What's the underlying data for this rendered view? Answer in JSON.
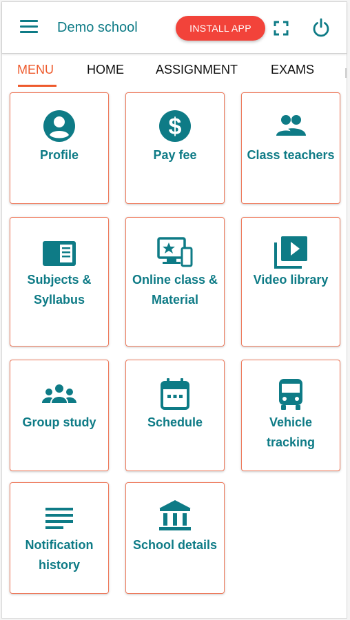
{
  "header": {
    "school_name": "Demo school",
    "install_label": "INSTALL APP",
    "menu_icon": "hamburger-menu-icon",
    "fullscreen_icon": "fullscreen-icon",
    "power_icon": "power-icon"
  },
  "tabs": [
    {
      "label": "MENU",
      "active": true
    },
    {
      "label": "HOME",
      "active": false
    },
    {
      "label": "ASSIGNMENT",
      "active": false
    },
    {
      "label": "EXAMS",
      "active": false
    }
  ],
  "tiles": [
    {
      "label": "Profile",
      "icon": "profile-icon"
    },
    {
      "label": "Pay fee",
      "icon": "dollar-icon"
    },
    {
      "label": "Class teachers",
      "icon": "people-icon"
    },
    {
      "label": "Subjects & Syllabus",
      "icon": "book-icon"
    },
    {
      "label": "Online class & Material",
      "icon": "online-class-icon"
    },
    {
      "label": "Video library",
      "icon": "video-library-icon"
    },
    {
      "label": "Group study",
      "icon": "group-icon"
    },
    {
      "label": "Schedule",
      "icon": "calendar-icon"
    },
    {
      "label": "Vehicle tracking",
      "icon": "bus-icon"
    },
    {
      "label": "Notification history",
      "icon": "notes-icon"
    },
    {
      "label": "School details",
      "icon": "school-building-icon"
    }
  ],
  "colors": {
    "primary": "#0e7b86",
    "accent": "#ee5a2c",
    "install": "#f2433a",
    "card_border": "#ee7a5c"
  }
}
